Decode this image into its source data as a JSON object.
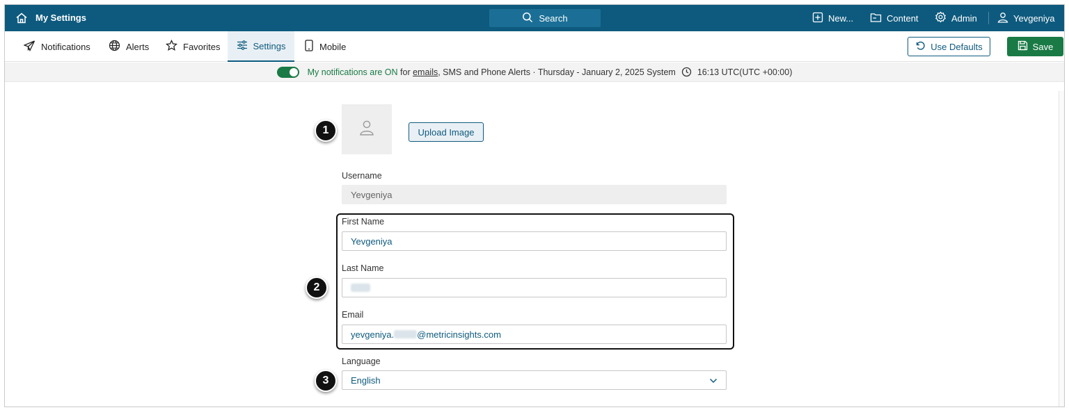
{
  "header": {
    "app_title": "My Settings",
    "search_label": "Search",
    "new_label": "New...",
    "content_label": "Content",
    "admin_label": "Admin",
    "user_label": "Yevgeniya"
  },
  "tabs": [
    {
      "label": "Notifications",
      "icon": "paper-plane-icon"
    },
    {
      "label": "Alerts",
      "icon": "globe-icon"
    },
    {
      "label": "Favorites",
      "icon": "star-icon"
    },
    {
      "label": "Settings",
      "icon": "sliders-icon",
      "active": true
    },
    {
      "label": "Mobile",
      "icon": "phone-icon"
    }
  ],
  "toolbar": {
    "use_defaults_label": "Use Defaults",
    "save_label": "Save"
  },
  "notice": {
    "status": "My notifications are ON",
    "for_text": "for",
    "emails_link": "emails",
    "rest": ", SMS and Phone Alerts · Thursday - January 2, 2025 System",
    "time": "16:13 UTC(UTC +00:00)"
  },
  "profile": {
    "upload_label": "Upload Image",
    "username_label": "Username",
    "username_value": "Yevgeniya",
    "first_name_label": "First Name",
    "first_name_value": "Yevgeniya",
    "last_name_label": "Last Name",
    "email_label": "Email",
    "email_prefix": "yevgeniya.",
    "email_suffix": "@metricinsights.com",
    "language_label": "Language",
    "language_value": "English"
  },
  "callouts": [
    "1",
    "2",
    "3"
  ],
  "colors": {
    "header_bg": "#0e5a7e",
    "save_green": "#197a45",
    "accent_blue": "#0e5a7e"
  }
}
